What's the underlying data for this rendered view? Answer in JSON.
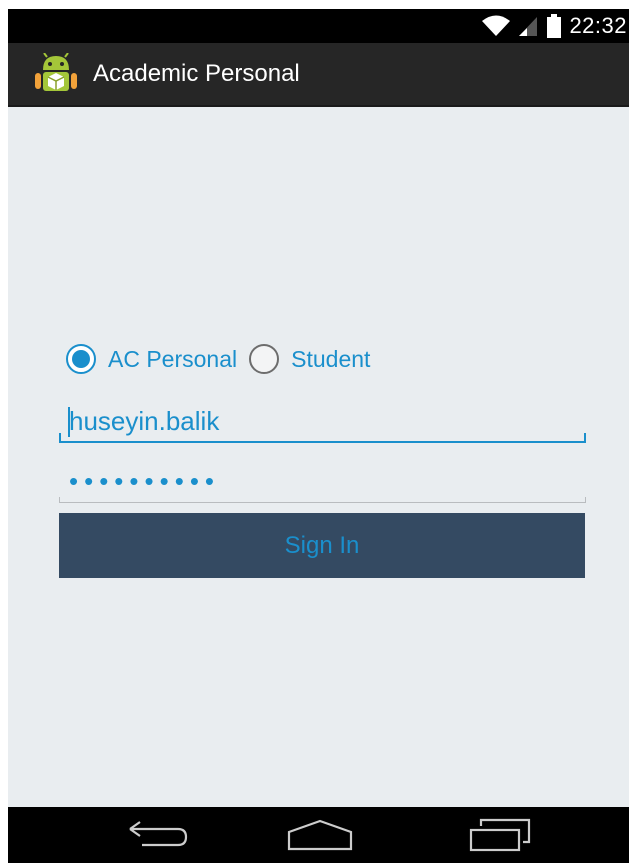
{
  "status_bar": {
    "time": "22:32"
  },
  "action_bar": {
    "title": "Academic Personal",
    "icon": "android-app-icon"
  },
  "login": {
    "radio_options": [
      {
        "label": "AC Personal",
        "checked": true
      },
      {
        "label": "Student",
        "checked": false
      }
    ],
    "username_value": "huseyin.balik",
    "password_value": "••••••••••",
    "sign_in_label": "Sign In"
  },
  "nav_bar": {
    "icons": [
      "back-icon",
      "home-icon",
      "recent-apps-icon"
    ]
  },
  "colors": {
    "accent": "#1a8fcc",
    "button": "#344a62",
    "background": "#e9edf0",
    "action_bar": "#262626"
  }
}
